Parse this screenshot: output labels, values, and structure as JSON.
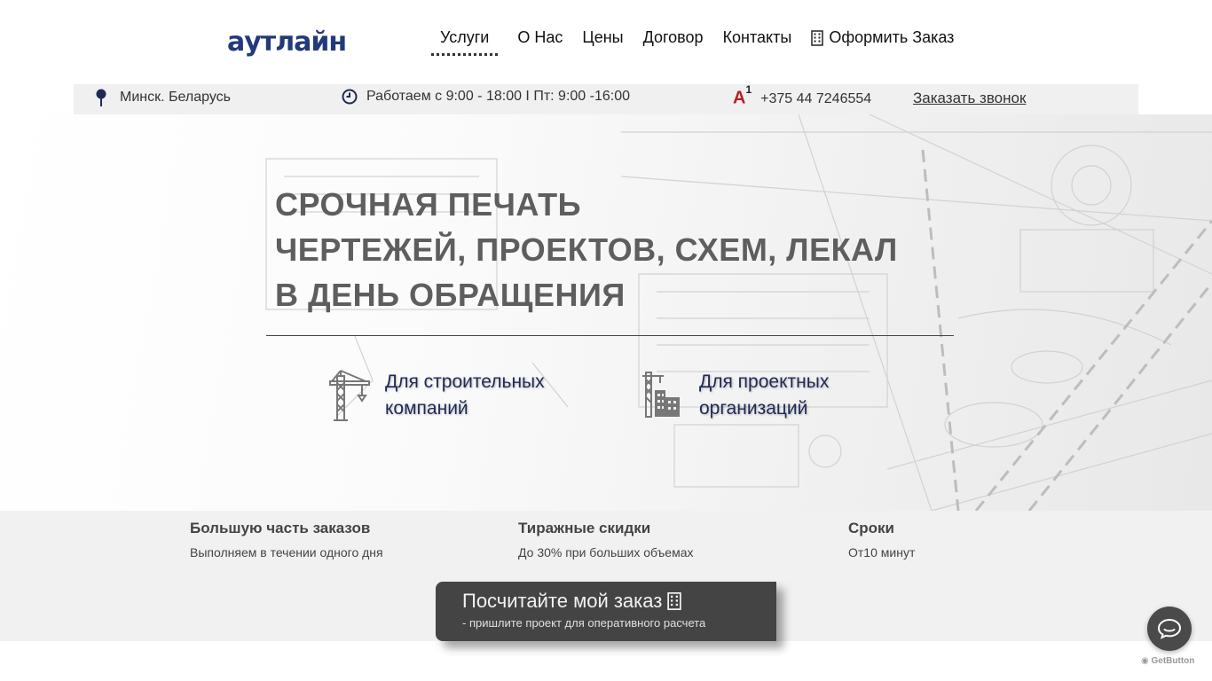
{
  "header": {
    "logo_text": "аутлайн",
    "nav": [
      {
        "label": "Услуги"
      },
      {
        "label": "О Нас"
      },
      {
        "label": "Цены"
      },
      {
        "label": "Договор"
      },
      {
        "label": "Контакты"
      }
    ],
    "order_label": "Оформить Заказ"
  },
  "infobar": {
    "location": "Минск. Беларусь",
    "hours": "Работаем с 9:00 - 18:00 I Пт: 9:00 -16:00",
    "operator_letter": "A",
    "operator_number": "1",
    "phone": "+375 44 7246554",
    "callback_label": "Заказать звонок"
  },
  "hero": {
    "title_line1": "СРОЧНАЯ ПЕЧАТЬ",
    "title_line2": "ЧЕРТЕЖЕЙ, ПРОЕКТОВ, СХЕМ, ЛЕКАЛ",
    "title_line3": "В ДЕНЬ ОБРАЩЕНИЯ",
    "services": [
      {
        "line1": "Для строительных",
        "line2": "компаний",
        "icon": "crane-icon"
      },
      {
        "line1": "Для проектных",
        "line2": "организаций",
        "icon": "building-crane-icon"
      }
    ]
  },
  "features": [
    {
      "title": "Большую часть заказов",
      "text": "Выполняем в течении одного дня"
    },
    {
      "title": "Тиражные скидки",
      "text": "До 30% при больших объемах"
    },
    {
      "title": "Сроки",
      "text": "От10 минут"
    }
  ],
  "cta": {
    "title": "Посчитайте мой заказ",
    "subtitle": "- пришлите проект для оперативного расчета"
  },
  "widget": {
    "brand": "GetButton"
  },
  "colors": {
    "brand_blue": "#223a7a",
    "accent_red": "#b3202a",
    "cta_bg": "#444444"
  }
}
